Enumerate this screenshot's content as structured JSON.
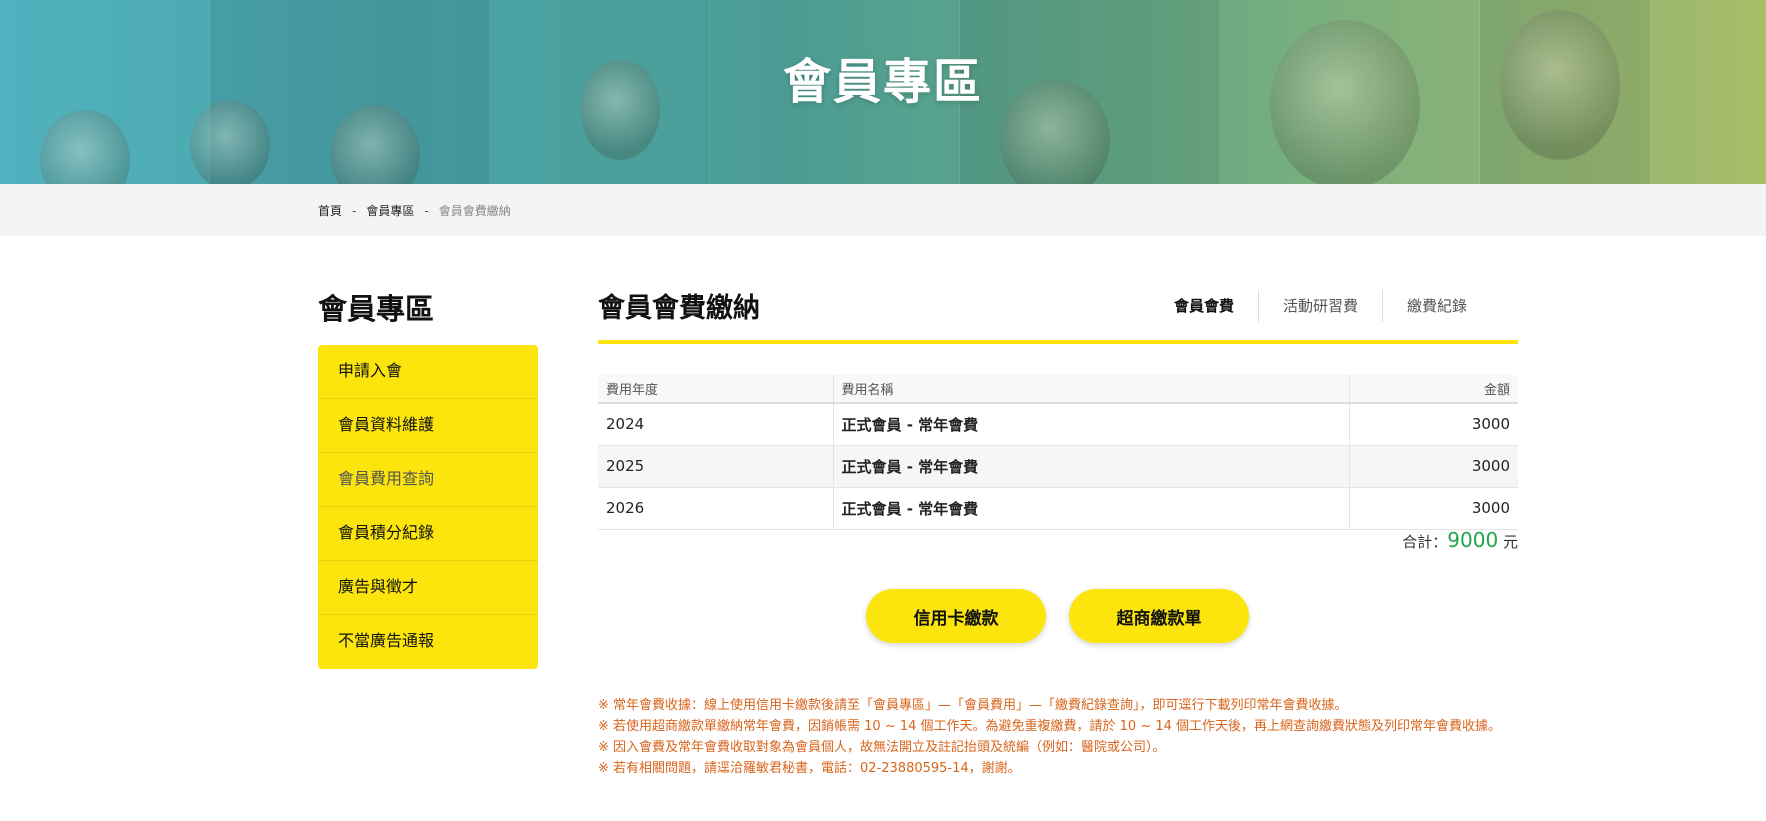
{
  "hero": {
    "title": "會員專區"
  },
  "breadcrumb": {
    "home": "首頁",
    "separator": "-",
    "section": "會員專區",
    "current": "會員會費繳納"
  },
  "sidebar": {
    "title": "會員專區",
    "items": [
      {
        "label": "申請入會",
        "active": false
      },
      {
        "label": "會員資料維護",
        "active": false
      },
      {
        "label": "會員費用查詢",
        "active": true
      },
      {
        "label": "會員積分紀錄",
        "active": false
      },
      {
        "label": "廣告與徵才",
        "active": false
      },
      {
        "label": "不當廣告通報",
        "active": false
      }
    ]
  },
  "main": {
    "title": "會員會費繳納",
    "tabs": [
      {
        "label": "會員會費",
        "active": true
      },
      {
        "label": "活動研習費",
        "active": false
      },
      {
        "label": "繳費紀錄",
        "active": false
      }
    ]
  },
  "table": {
    "headers": {
      "year": "費用年度",
      "name": "費用名稱",
      "amount": "金額"
    },
    "rows": [
      {
        "year": "2024",
        "name": "正式會員 - 常年會費",
        "amount": "3000"
      },
      {
        "year": "2025",
        "name": "正式會員 - 常年會費",
        "amount": "3000"
      },
      {
        "year": "2026",
        "name": "正式會員 - 常年會費",
        "amount": "3000"
      }
    ]
  },
  "total": {
    "label": "合計：",
    "value": "9000",
    "unit": "元"
  },
  "buttons": {
    "credit_card": "信用卡繳款",
    "convenience_store": "超商繳款單"
  },
  "notes": [
    "※ 常年會費收據：線上使用信用卡繳款後請至「會員專區」—「會員費用」—「繳費紀錄查詢」，即可逕行下載列印常年會費收據。",
    "※ 若使用超商繳款單繳納常年會費，因銷帳需 10 ~ 14 個工作天。為避免重複繳費，請於 10 ~ 14 個工作天後，再上網查詢繳費狀態及列印常年會費收據。",
    "※ 因入會費及常年會費收取對象為會員個人，故無法開立及註記抬頭及統編（例如：醫院或公司）。",
    "※ 若有相關問題，請逕洽羅敏君秘書，電話：02-23880595-14，謝謝。"
  ],
  "colors": {
    "accent_yellow": "#fbe50c",
    "total_green": "#1fa64a",
    "note_orange": "#d9641b"
  }
}
